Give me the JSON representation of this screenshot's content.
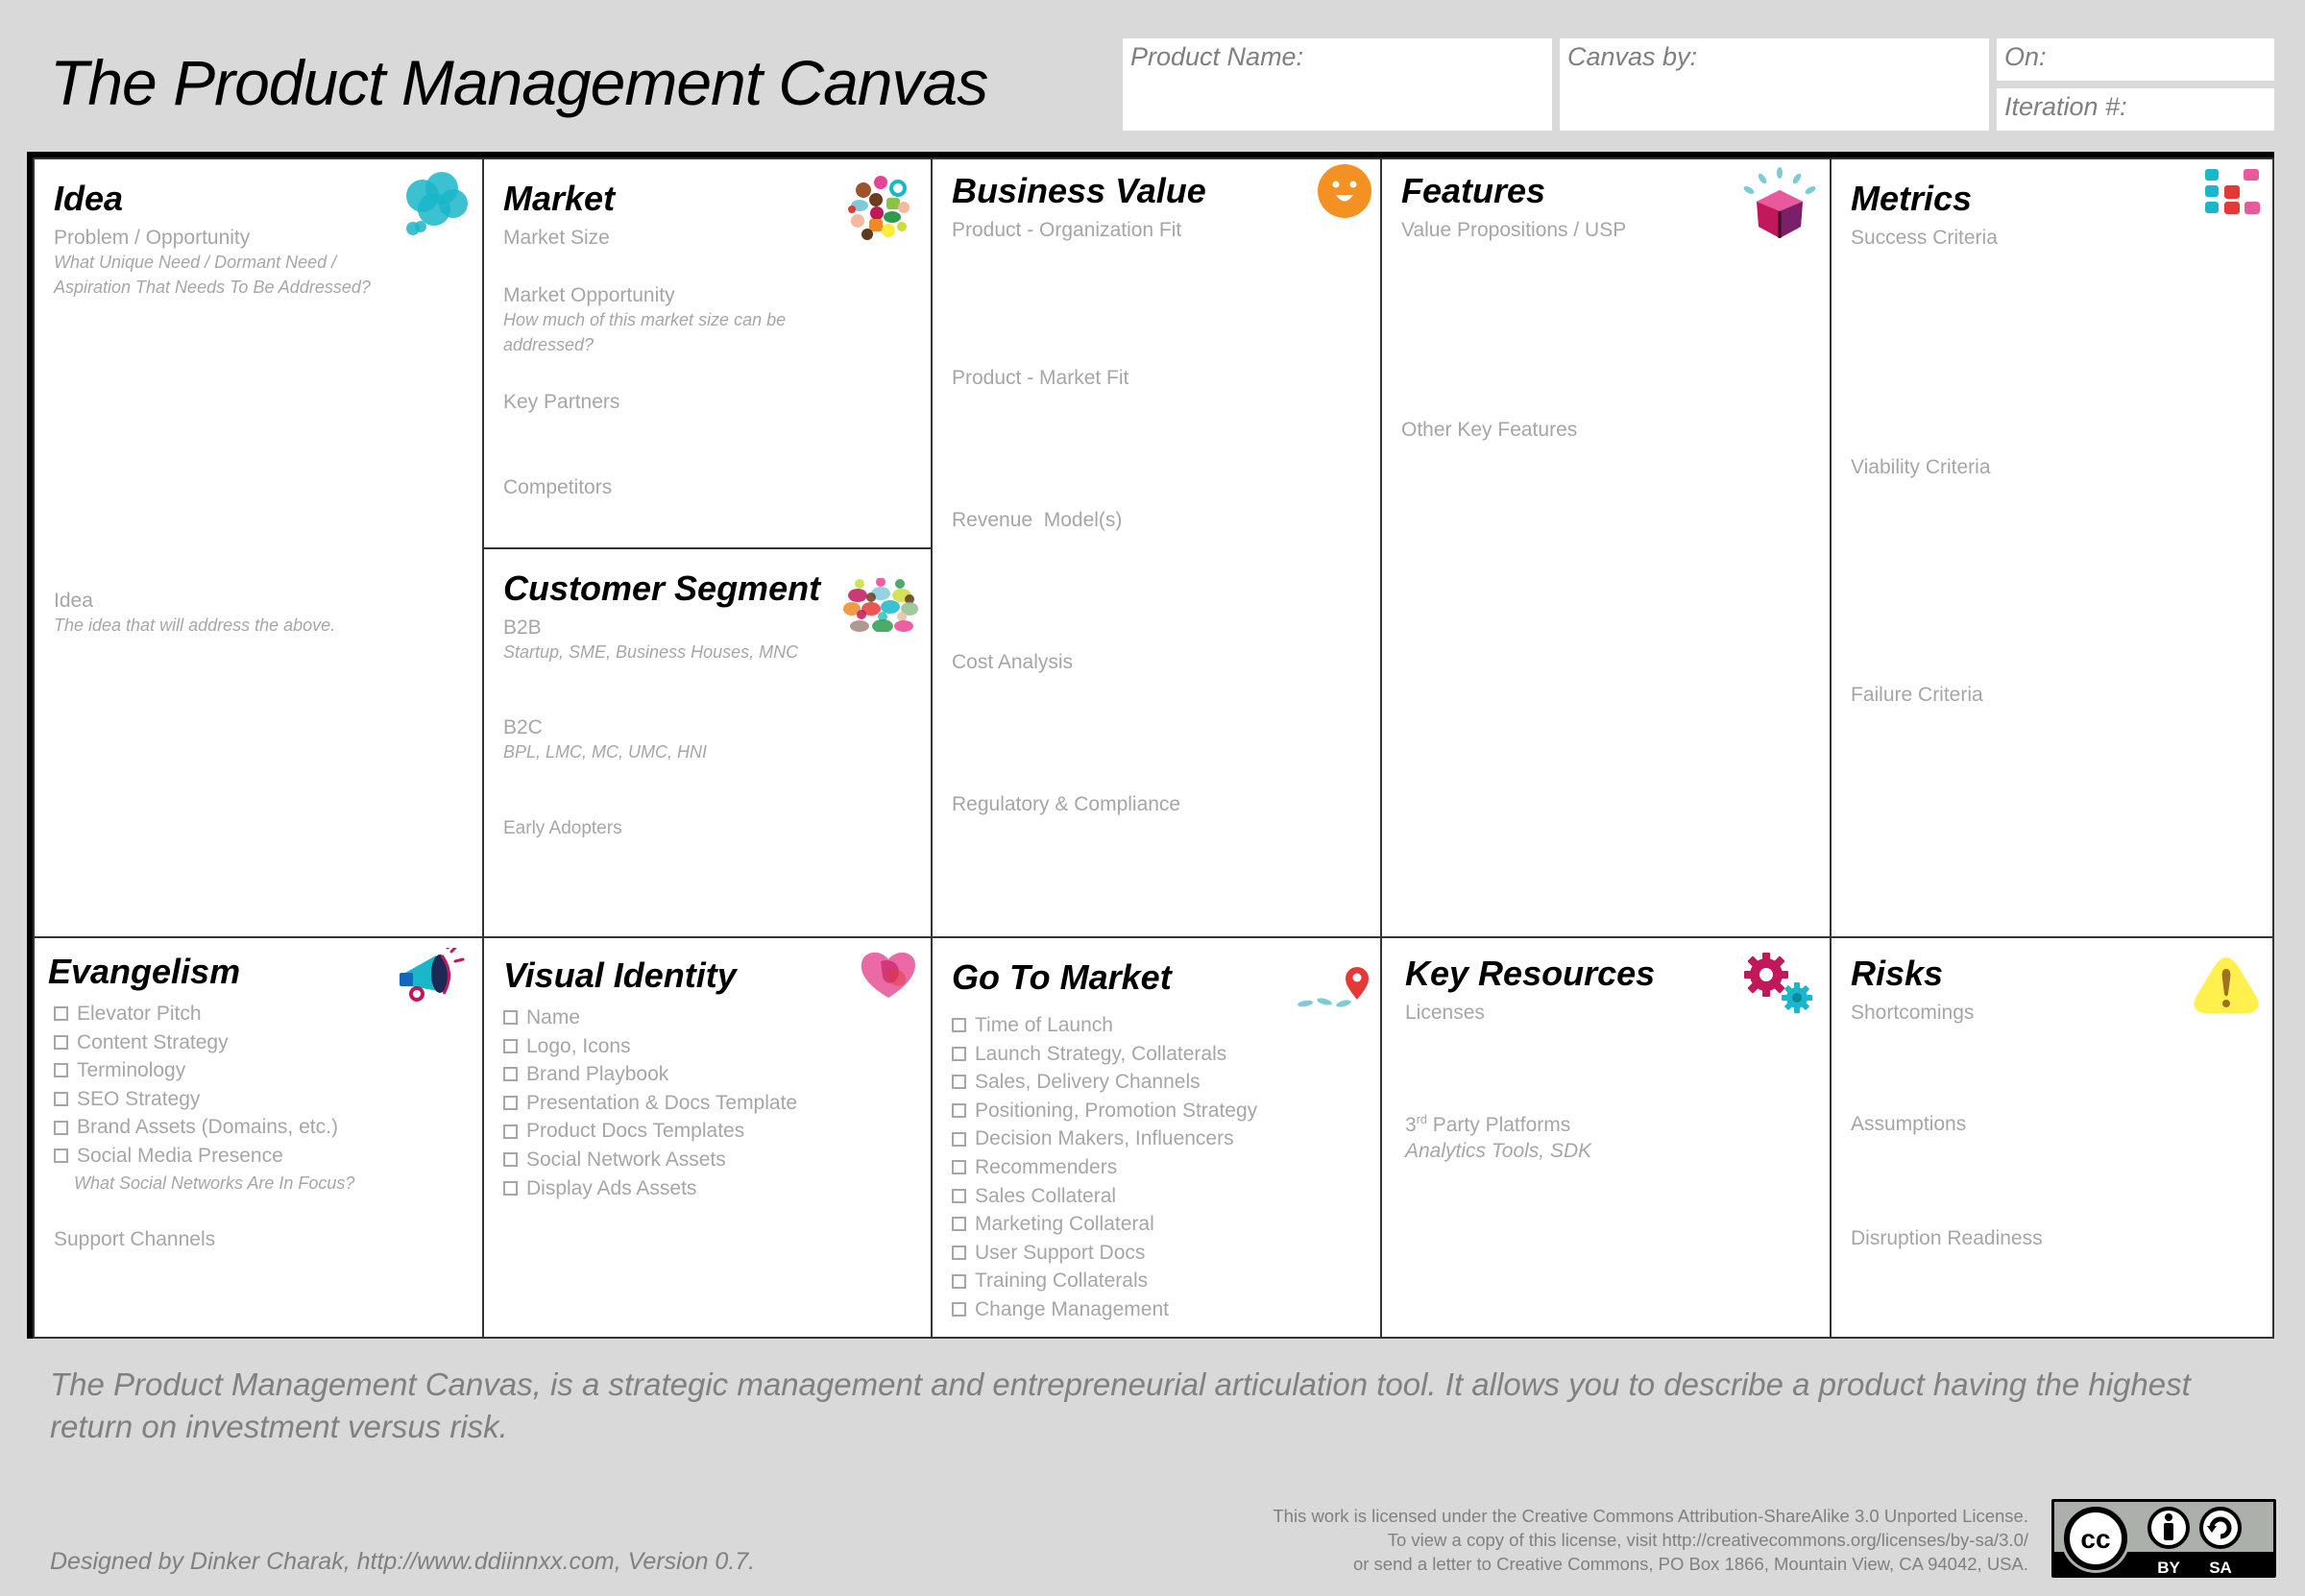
{
  "header": {
    "title": "The Product Management Canvas",
    "fields": {
      "product_name": "Product Name:",
      "canvas_by": "Canvas by:",
      "on": "On:",
      "iteration": "Iteration #:"
    }
  },
  "colors": {
    "background": "#d9d9d9",
    "label_gray": "#a6a6a6",
    "footer_gray": "#808080",
    "teal": "#1ab6c9",
    "orange": "#f39222",
    "magenta": "#c2185b",
    "pink": "#e85a9b",
    "red": "#e53935",
    "yellow": "#fff04d"
  },
  "cells": {
    "idea": {
      "title": "Idea",
      "icon": "thought-bubble-icon",
      "problem": "Problem / Opportunity",
      "problem_hint_1": "What Unique Need / Dormant Need /",
      "problem_hint_2": "Aspiration That Needs To Be Addressed?",
      "idea_label": "Idea",
      "idea_hint": "The idea that will address the above."
    },
    "market": {
      "title": "Market",
      "icon": "colorful-shapes-icon",
      "market_size": "Market Size",
      "market_opportunity": "Market Opportunity",
      "market_opportunity_hint_1": "How much of this market size can be",
      "market_opportunity_hint_2": "addressed?",
      "key_partners": "Key Partners",
      "competitors": "Competitors"
    },
    "customer_segment": {
      "title": "Customer Segment",
      "icon": "people-group-icon",
      "b2b": "B2B",
      "b2b_hint": "Startup, SME, Business Houses, MNC",
      "b2c": "B2C",
      "b2c_hint": "BPL, LMC, MC, UMC, HNI",
      "early_adopters": "Early Adopters"
    },
    "business_value": {
      "title": "Business Value",
      "icon": "smiley-icon",
      "items": [
        "Product - Organization Fit",
        "Product - Market Fit",
        "Revenue  Model(s)",
        "Cost Analysis",
        "Regulatory & Compliance"
      ]
    },
    "features": {
      "title": "Features",
      "icon": "gem-cube-icon",
      "value_propositions": "Value Propositions / USP",
      "other_features": "Other Key Features"
    },
    "metrics": {
      "title": "Metrics",
      "icon": "dot-grid-icon",
      "success": "Success Criteria",
      "viability": "Viability Criteria",
      "failure": "Failure Criteria"
    },
    "evangelism": {
      "title": "Evangelism",
      "icon": "megaphone-icon",
      "checklist": [
        "Elevator Pitch",
        "Content Strategy",
        "Terminology",
        "SEO Strategy",
        "Brand Assets (Domains, etc.)",
        "Social Media Presence"
      ],
      "social_hint": "What Social Networks Are In Focus?",
      "support_channels": "Support Channels"
    },
    "visual_identity": {
      "title": "Visual Identity",
      "icon": "heart-icon",
      "checklist": [
        "Name",
        "Logo, Icons",
        "Brand Playbook",
        "Presentation & Docs Template",
        "Product Docs Templates",
        "Social Network Assets",
        "Display Ads Assets"
      ]
    },
    "go_to_market": {
      "title": "Go To Market",
      "icon": "map-pin-path-icon",
      "checklist": [
        "Time of Launch",
        "Launch Strategy, Collaterals",
        "Sales, Delivery Channels",
        "Positioning, Promotion Strategy",
        "Decision Makers, Influencers",
        "Recommenders",
        "Sales Collateral",
        "Marketing Collateral",
        "User Support Docs",
        "Training Collaterals",
        "Change Management"
      ]
    },
    "key_resources": {
      "title": "Key Resources",
      "icon": "gears-icon",
      "licenses": "Licenses",
      "third_party_num": "3",
      "third_party_sup": "rd",
      "third_party_rest": " Party Platforms",
      "third_party_hint": "Analytics Tools, SDK"
    },
    "risks": {
      "title": "Risks",
      "icon": "warning-icon",
      "shortcomings": "Shortcomings",
      "assumptions": "Assumptions",
      "disruption": "Disruption Readiness"
    }
  },
  "footer": {
    "description": "The Product Management Canvas, is a strategic management and entrepreneurial articulation tool. It allows you to describe a product having the highest return on investment versus risk.",
    "designer": "Designed by Dinker Charak, http://www.ddiinnxx.com, Version 0.7.",
    "license_lines": [
      "This work is licensed under the Creative Commons Attribution-ShareAlike 3.0 Unported License.",
      "To view a copy of this license, visit http://creativecommons.org/licenses/by-sa/3.0/",
      "or send a letter to Creative Commons, PO Box 1866, Mountain View, CA 94042, USA."
    ],
    "cc_badge": {
      "cc": "cc",
      "by": "BY",
      "sa": "SA"
    }
  }
}
